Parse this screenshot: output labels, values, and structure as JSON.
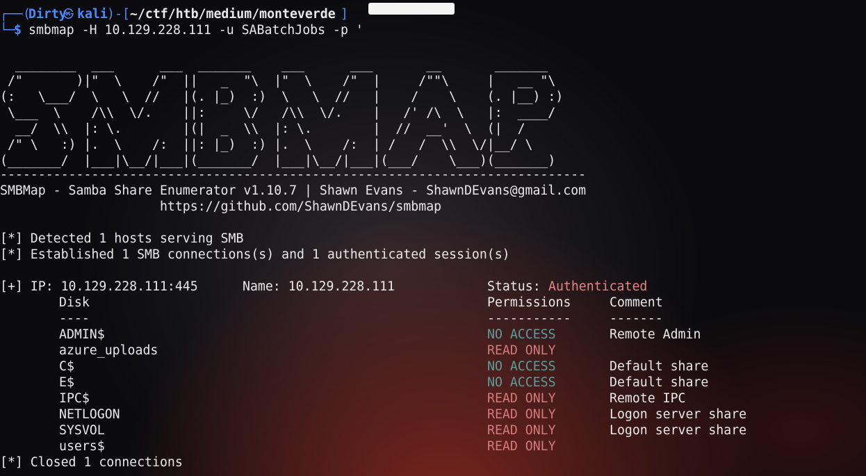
{
  "prompt": {
    "corner_top": "┌──",
    "paren_open": "(",
    "user": "Dirty",
    "at_icon": "㉿",
    "host": "kali",
    "paren_close": ")",
    "sep": "-",
    "bracket_open": "[",
    "cwd": "~/ctf/htb/medium/monteverde",
    "bracket_close": "]",
    "corner_bottom": "└─",
    "dollar": "$",
    "command": "smbmap -H 10.129.228.111 -u SABatchJobs -p '"
  },
  "banner": {
    "ascii_art": "  ________  ___      ___  _______    ___      ___       __       _______\n /\"       )|\"  \\    /\"  ||   _  \"\\  |\"  \\    /\"  |     /\"\"\\     |   __ \"\\\n(:   \\___/  \\   \\  //   |(. |_)  :)  \\   \\  //   |    /    \\    (. |__) :)\n \\___  \\    /\\\\  \\/.    ||:     \\/   /\\\\  \\/.    |   /' /\\  \\   |:  ____/\n  __/  \\\\  |: \\.        |(|  _  \\\\  |: \\.        |  //  __'  \\  (|  /\n /\" \\   :) |.  \\    /:  ||: |_)  :) |.  \\    /:  | /   /  \\\\  \\/|__/ \\\n(_______/  |___|\\__/|___|(_______/  |___|\\__/|___|(___/    \\___)(_______)",
    "divider": "-----------------------------------------------------------------------------",
    "tool_line": "SMBMap - Samba Share Enumerator v1.10.7 | Shawn Evans - ShawnDEvans@gmail.com",
    "url_line": "                     https://github.com/ShawnDEvans/smbmap"
  },
  "status_lines": {
    "detected": "[*] Detected 1 hosts serving SMB",
    "established": "[*] Established 1 SMB connections(s) and 1 authenticated session(s)",
    "closed": "[*] Closed 1 connections"
  },
  "host": {
    "ip_label": "[+] IP: 10.129.228.111:445",
    "name_label": "Name: 10.129.228.111",
    "status_label": "Status: ",
    "status_value": "Authenticated"
  },
  "table": {
    "col_disk": "Disk",
    "col_permissions": "Permissions",
    "col_comment": "Comment",
    "sep_disk": "----",
    "sep_permissions": "-----------",
    "sep_comment": "-------",
    "rows": [
      {
        "disk": "ADMIN$",
        "permissions": "NO ACCESS",
        "comment": "Remote Admin"
      },
      {
        "disk": "azure_uploads",
        "permissions": "READ ONLY",
        "comment": ""
      },
      {
        "disk": "C$",
        "permissions": "NO ACCESS",
        "comment": "Default share"
      },
      {
        "disk": "E$",
        "permissions": "NO ACCESS",
        "comment": "Default share"
      },
      {
        "disk": "IPC$",
        "permissions": "READ ONLY",
        "comment": "Remote IPC"
      },
      {
        "disk": "NETLOGON",
        "permissions": "READ ONLY",
        "comment": "Logon server share"
      },
      {
        "disk": "SYSVOL",
        "permissions": "READ ONLY",
        "comment": "Logon server share"
      },
      {
        "disk": "users$",
        "permissions": "READ ONLY",
        "comment": ""
      }
    ]
  },
  "colors": {
    "prompt_frame": "#4b8bff",
    "no_access": "#5c9c9c",
    "read_only": "#d47a7a",
    "authenticated": "#e38585"
  }
}
